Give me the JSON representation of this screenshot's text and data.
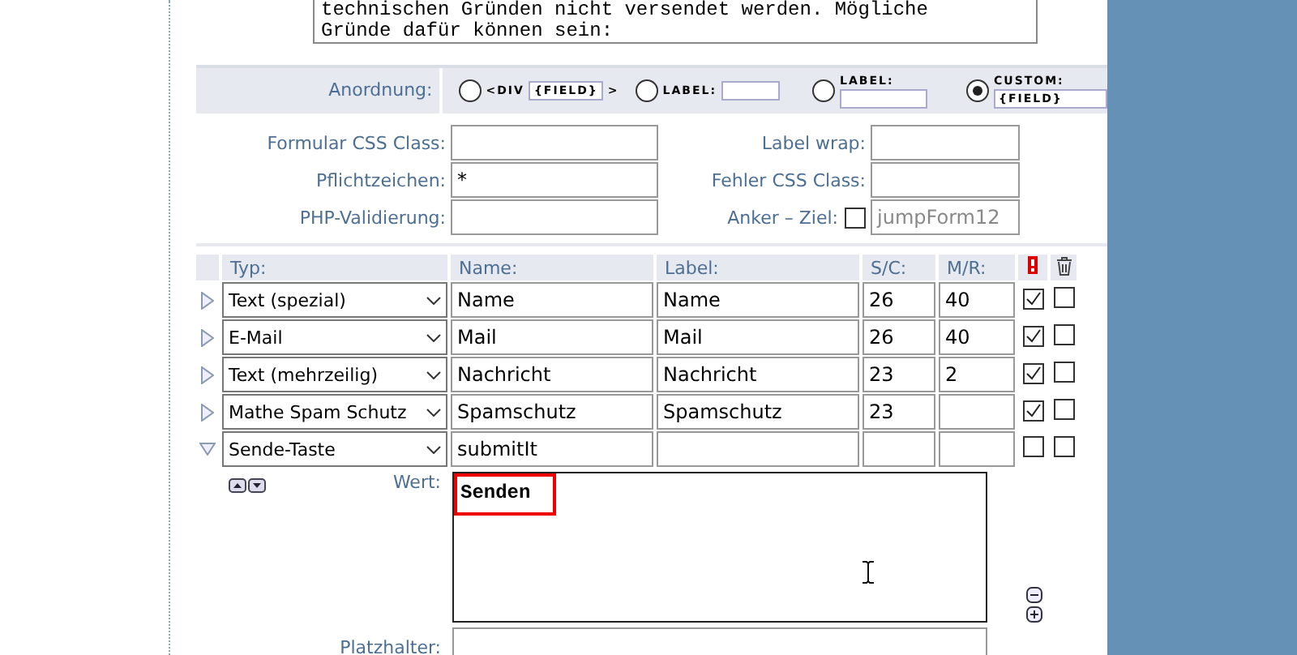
{
  "message_text": [
    "technischen Gründen nicht versendet werden. Mögliche",
    "Gründe dafür können sein:"
  ],
  "layout": {
    "label": "Anordnung:",
    "options": [
      {
        "kind": "div",
        "parts": [
          "<DIV",
          "{FIELD}",
          ">"
        ],
        "selected": false
      },
      {
        "kind": "label_inline",
        "parts": [
          "LABEL:"
        ],
        "selected": false
      },
      {
        "kind": "label_above",
        "parts": [
          "LABEL:"
        ],
        "selected": false
      },
      {
        "kind": "custom",
        "parts": [
          "CUSTOM:",
          "{FIELD}"
        ],
        "selected": true
      }
    ]
  },
  "settings": [
    {
      "label": "Formular CSS Class:"
    },
    {
      "label": "Label wrap:"
    },
    {
      "label": "Pflichtzeichen:",
      "value": "*"
    },
    {
      "label": "Fehler CSS Class:"
    },
    {
      "label": "PHP-Validierung:"
    },
    {
      "label": "Anker – Ziel:",
      "placeholder": "jumpForm12",
      "checked": false
    }
  ],
  "table": {
    "columns": [
      "Typ:",
      "Name:",
      "Label:",
      "S/C:",
      "M/R:"
    ],
    "rows": [
      {
        "expanded": false,
        "type": "Text (spezial)",
        "name": "Name",
        "label": "Name",
        "sc": "26",
        "mr": "40",
        "required": true,
        "delete": false
      },
      {
        "expanded": false,
        "type": "E-Mail",
        "name": "Mail",
        "label": "Mail",
        "sc": "26",
        "mr": "40",
        "required": true,
        "delete": false
      },
      {
        "expanded": false,
        "type": "Text (mehrzeilig)",
        "name": "Nachricht",
        "label": "Nachricht",
        "sc": "23",
        "mr": "2",
        "required": true,
        "delete": false
      },
      {
        "expanded": false,
        "type": "Mathe Spam Schutz",
        "name": "Spamschutz",
        "label": "Spamschutz",
        "sc": "23",
        "required": true,
        "delete": false
      },
      {
        "expanded": true,
        "type": "Sende-Taste",
        "name": "submitIt",
        "required": false,
        "delete": false
      }
    ]
  },
  "detail": {
    "value_label": "Wert:",
    "value": "Senden",
    "placeholder_label": "Platzhalter:"
  }
}
